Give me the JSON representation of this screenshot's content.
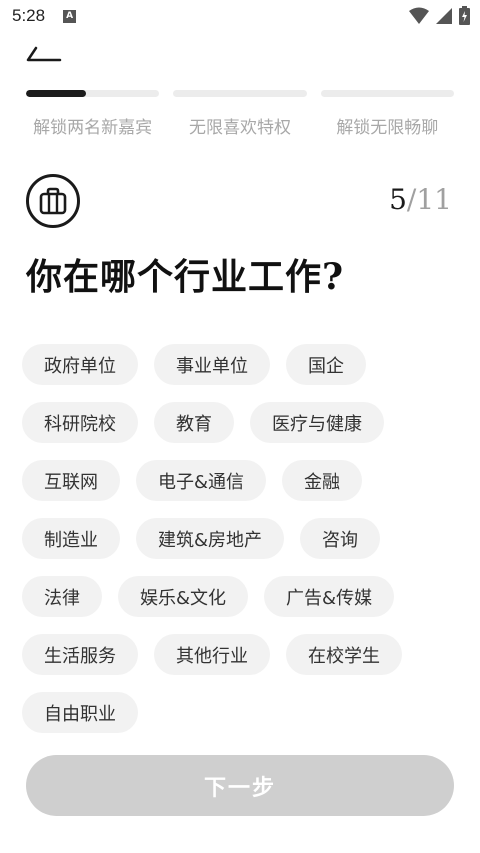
{
  "status_bar": {
    "time": "5:28",
    "notification_badge": "A",
    "icons": [
      "wifi-icon",
      "signal-icon",
      "battery-charging-icon"
    ]
  },
  "header": {
    "back_icon": "back-icon"
  },
  "progress": {
    "segments": [
      {
        "label": "解锁两名新嘉宾",
        "progress": 0.45
      },
      {
        "label": "无限喜欢特权",
        "progress": 0
      },
      {
        "label": "解锁无限畅聊",
        "progress": 0
      }
    ]
  },
  "step": {
    "icon": "briefcase-icon",
    "current": "5",
    "separator": "/",
    "total": "11"
  },
  "question": "你在哪个行业工作?",
  "options": [
    "政府单位",
    "事业单位",
    "国企",
    "科研院校",
    "教育",
    "医疗与健康",
    "互联网",
    "电子&通信",
    "金融",
    "制造业",
    "建筑&房地产",
    "咨询",
    "法律",
    "娱乐&文化",
    "广告&传媒",
    "生活服务",
    "其他行业",
    "在校学生",
    "自由职业"
  ],
  "next_button": {
    "label": "下一步",
    "enabled": false
  },
  "colors": {
    "progress_active": "#1c1c1c",
    "progress_track": "#ececec",
    "chip_bg": "#f2f2f2",
    "button_disabled": "#cfcfcf"
  }
}
